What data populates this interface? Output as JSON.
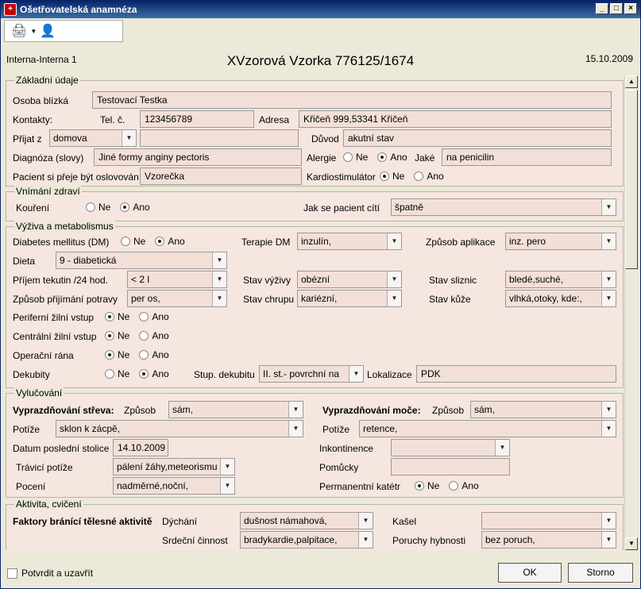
{
  "window": {
    "title": "Ošetřovatelská anamnéza",
    "minimize": "_",
    "maximize": "□",
    "close": "×"
  },
  "toolbar": {
    "printer": "🖨",
    "arrow": "▼",
    "user": "👤"
  },
  "header": {
    "department": "Interna-Interna 1",
    "patient": "XVzorová Vzorka 776125/1674",
    "date": "15.10.2009"
  },
  "zakladni": {
    "legend": "Základní údaje",
    "osoba_label": "Osoba blízká",
    "osoba_value": "Testovací Testka",
    "kontakty_label": "Kontakty:",
    "tel_label": "Tel. č.",
    "tel_value": "123456789",
    "adresa_label": "Adresa",
    "adresa_value": "Křičeň 999,53341 Křičeň",
    "prijat_label": "Přijat z",
    "prijat_value": "domova",
    "prijat_extra": "",
    "duvod_label": "Důvod",
    "duvod_value": "akutní stav",
    "diagnoza_label": "Diagnóza (slovy)",
    "diagnoza_value": "Jiné formy anginy pectoris",
    "alergie_label": "Alergie",
    "ne": "Ne",
    "ano": "Ano",
    "alergie_selected": "Ano",
    "jake_label": "Jaké",
    "jake_value": "na penicilin",
    "osloveni_label": "Pacient si přeje být oslovován",
    "osloveni_value": "Vzorečka",
    "kardio_label": "Kardiostimulátor",
    "kardio_selected": "Ne"
  },
  "vnimani": {
    "legend": "Vnímání zdraví",
    "koureni_label": "Kouření",
    "koureni_selected": "Ano",
    "jak_label": "Jak se pacient cítí",
    "jak_value": "špatně"
  },
  "vyziva": {
    "legend": "Výživa a metabolismus",
    "dm_label": "Diabetes mellitus (DM)",
    "dm_selected": "Ano",
    "terapie_label": "Terapie DM",
    "terapie_value": "inzulín,",
    "zpusob_apl_label": "Způsob aplikace",
    "zpusob_apl_value": "inz. pero",
    "dieta_label": "Dieta",
    "dieta_value": "9 - diabetická",
    "prijem_label": "Příjem tekutin /24 hod.",
    "prijem_value": "< 2 l",
    "stav_vyzivy_label": "Stav výživy",
    "stav_vyzivy_value": "obézní",
    "stav_sliznic_label": "Stav sliznic",
    "stav_sliznic_value": "bledé,suché,",
    "zpusob_prij_label": "Způsob přijímání potravy",
    "zpusob_prij_value": "per os,",
    "stav_chrupu_label": "Stav chrupu",
    "stav_chrupu_value": "kariézní,",
    "stav_kuze_label": "Stav kůže",
    "stav_kuze_value": "vlhká,otoky, kde:,",
    "periferni_label": "Periferní žilní vstup",
    "periferni_selected": "Ne",
    "centralni_label": "Centrální žilní vstup",
    "centralni_selected": "Ne",
    "operacni_label": "Operační rána",
    "operacni_selected": "Ne",
    "dekubity_label": "Dekubity",
    "dekubity_selected": "Ano",
    "stup_label": "Stup. dekubitu",
    "stup_value": "II. st.- povrchní na",
    "lokalizace_label": "Lokalizace",
    "lokalizace_value": "PDK"
  },
  "vylucovani": {
    "legend": "Vylučování",
    "streva_label": "Vyprazdňování střeva:",
    "zpusob_label": "Způsob",
    "streva_zpusob": "sám,",
    "mocе_label": "Vyprazdňování moče:",
    "moce_zpusob": "sám,",
    "potize_label": "Potíže",
    "streva_potize": "sklon k zácpě,",
    "moce_potize": "retence,",
    "datum_label": "Datum poslední stolice",
    "datum_value": "14.10.2009",
    "inkontinence_label": "Inkontinence",
    "inkontinence_value": "",
    "travici_label": "Trávicí potíže",
    "travici_value": "pálení žáhy,meteorismu",
    "pomucky_label": "Pomůcky",
    "pomucky_value": "",
    "poceni_label": "Pocení",
    "poceni_value": "nadměrné,noční,",
    "katetr_label": "Permanentní katétr",
    "katetr_selected": "Ne"
  },
  "aktivita": {
    "legend": "Aktivita, cvičení",
    "faktory_label": "Faktory bránící tělesné aktivitě",
    "dychani_label": "Dýchání",
    "dychani_value": "dušnost námahová,",
    "kasel_label": "Kašel",
    "kasel_value": "",
    "srdecni_label": "Srdeční činnost",
    "srdecni_value": "bradykardie,palpitace,",
    "poruchy_label": "Poruchy hybnosti",
    "poruchy_value": "bez poruch,"
  },
  "footer": {
    "confirm_label": "Potvrdit a uzavřít",
    "ok": "OK",
    "cancel": "Storno"
  },
  "icons": {
    "dropdown": "▼",
    "scroll_up": "▲",
    "scroll_down": "▼"
  }
}
